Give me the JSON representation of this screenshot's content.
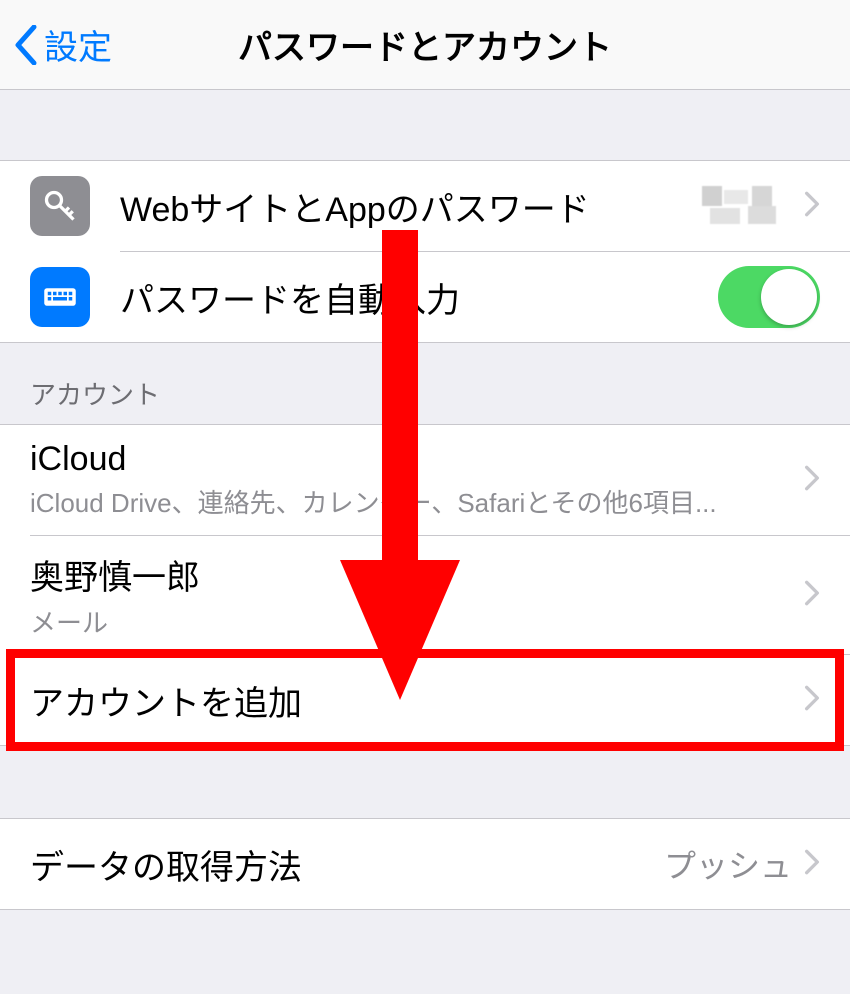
{
  "nav": {
    "back_label": "設定",
    "title": "パスワードとアカウント"
  },
  "section1": {
    "passwords_label": "WebサイトとAppのパスワード",
    "autofill_label": "パスワードを自動入力",
    "autofill_on": true
  },
  "accounts_header": "アカウント",
  "accounts": [
    {
      "title": "iCloud",
      "subtitle": "iCloud Drive、連絡先、カレンダー、Safariとその他6項目..."
    },
    {
      "title": "奥野慎一郎",
      "subtitle": "メール"
    }
  ],
  "add_account_label": "アカウントを追加",
  "fetch": {
    "label": "データの取得方法",
    "value": "プッシュ"
  }
}
